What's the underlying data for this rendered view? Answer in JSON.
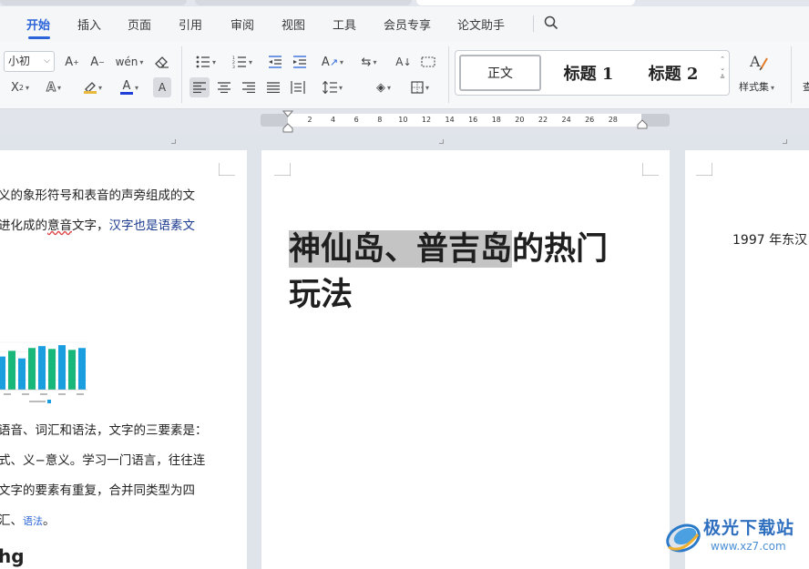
{
  "app": {
    "menu_tabs": [
      "开始",
      "插入",
      "页面",
      "引用",
      "审阅",
      "视图",
      "工具",
      "会员专享",
      "论文助手"
    ],
    "active_tab": "开始"
  },
  "ribbon": {
    "font_size": "小初",
    "styles": {
      "normal": "正文",
      "heading1": "标题 1",
      "heading2": "标题 2"
    },
    "styles_menu_label": "样式集",
    "accent_color": "#2b64d8",
    "font_color_bar": "#1f3fd6",
    "highlight_color_bar": "#e8b93a"
  },
  "ruler": {
    "ticks": [
      "2",
      "4",
      "6",
      "8",
      "10",
      "12",
      "14",
      "16",
      "18",
      "20",
      "22",
      "24",
      "26",
      "28"
    ]
  },
  "left_page": {
    "line1": "义的象形符号和表音的声旁组成的文",
    "line2_a": "进化成的",
    "line2_b": "意音",
    "line2_c": "文字，",
    "line2_d": "汉字也是语素文",
    "line3": "语音、词汇和语法，文字的三要素是：",
    "line4": "式、义−意义。学习一门语言，往往连",
    "line5": "文字的要素有重复，合并同类型为四",
    "line6_a": "汇、",
    "line6_b": "语法",
    "line6_c": "。",
    "bottom_fragment": "hg",
    "chart_data": {
      "type": "bar",
      "bar_colors": [
        "#1a9ee0",
        "#19b87a"
      ],
      "values": [
        70,
        82,
        66,
        88,
        92,
        86,
        94,
        84,
        88
      ]
    }
  },
  "center_page": {
    "title_selected": "神仙岛、普吉岛",
    "title_rest_line1": "的热门",
    "title_line2": "玩法"
  },
  "right_page": {
    "line1": "1997 年东汉"
  },
  "watermark": {
    "brand": "极光下载站",
    "url": "www.xz7.com"
  }
}
